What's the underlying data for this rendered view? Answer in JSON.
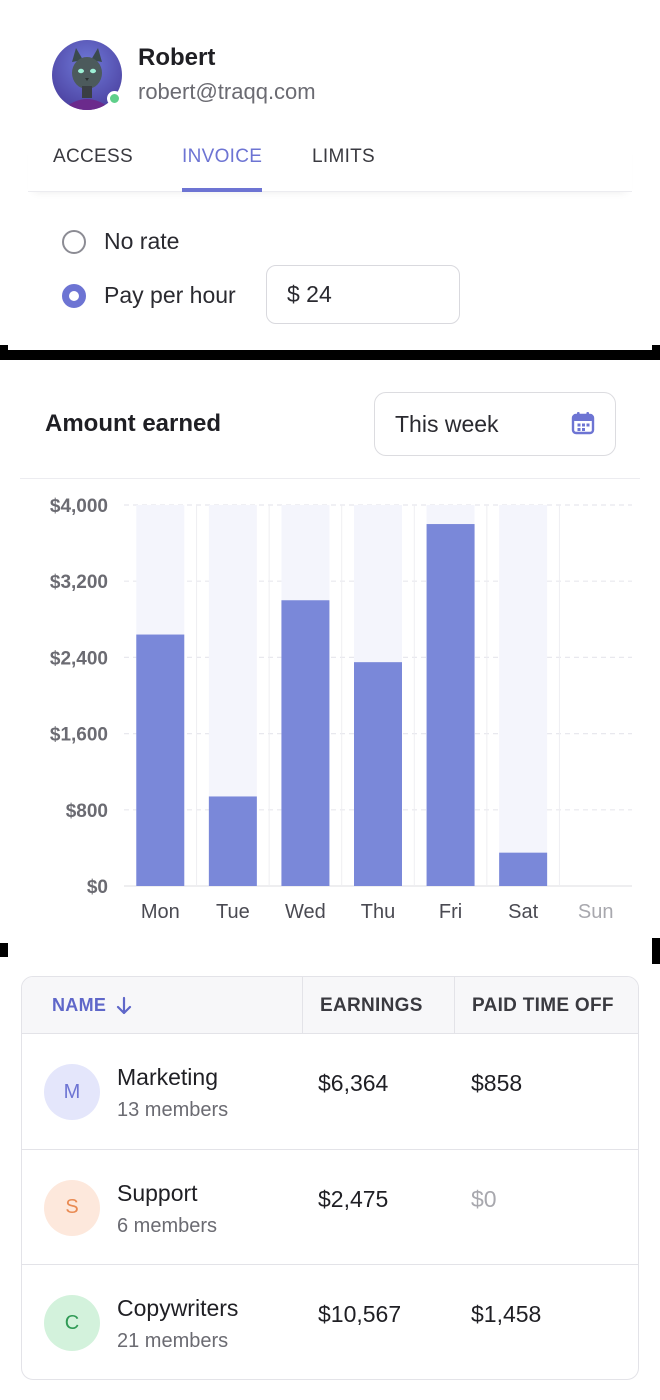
{
  "user": {
    "name": "Robert",
    "email": "robert@traqq.com",
    "status_color": "#5fcf8a"
  },
  "tabs": [
    {
      "label": "ACCESS",
      "active": false
    },
    {
      "label": "INVOICE",
      "active": true
    },
    {
      "label": "LIMITS",
      "active": false
    }
  ],
  "rate_options": {
    "no_rate_label": "No rate",
    "pay_per_hour_label": "Pay per hour",
    "selected": "pay_per_hour",
    "rate_value": "$ 24"
  },
  "earnings": {
    "title": "Amount earned",
    "period": "This week",
    "period_icon": "calendar-icon"
  },
  "chart_data": {
    "type": "bar",
    "categories": [
      "Mon",
      "Tue",
      "Wed",
      "Thu",
      "Fri",
      "Sat",
      "Sun"
    ],
    "values": [
      2640,
      940,
      3000,
      2350,
      3800,
      350,
      0
    ],
    "y_tick_labels": [
      "$4,000",
      "$3,200",
      "$2,400",
      "$1,600",
      "$800",
      "$0"
    ],
    "ylim": [
      0,
      4000
    ],
    "grid": true,
    "bar_color": "#7a88d9",
    "background_bar_color": "#f4f5fc",
    "muted_categories": [
      "Sun"
    ]
  },
  "table": {
    "headers": {
      "name": "NAME",
      "earnings": "EARNINGS",
      "pto": "PAID TIME OFF"
    },
    "sort_icon": "arrow-down-icon",
    "rows": [
      {
        "initial": "M",
        "name": "Marketing",
        "members": "13 members",
        "earnings": "$6,364",
        "pto": "$858",
        "badge_bg": "#e4e6fb",
        "badge_fg": "#6d74d3"
      },
      {
        "initial": "S",
        "name": "Support",
        "members": "6 members",
        "earnings": "$2,475",
        "pto": "$0",
        "badge_bg": "#fde8dc",
        "badge_fg": "#e98a52"
      },
      {
        "initial": "C",
        "name": "Copywriters",
        "members": "21 members",
        "earnings": "$10,567",
        "pto": "$1,458",
        "badge_bg": "#d3f2dc",
        "badge_fg": "#2f9a55"
      }
    ]
  }
}
